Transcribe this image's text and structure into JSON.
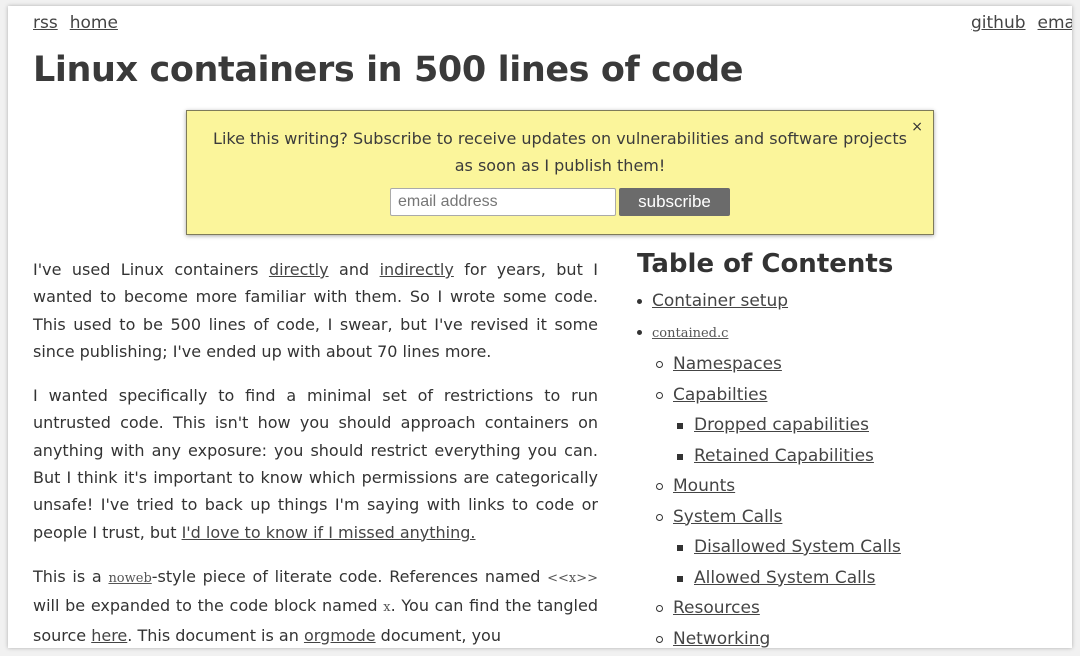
{
  "nav": {
    "left": [
      "rss",
      "home"
    ],
    "right": [
      "github",
      "ema"
    ]
  },
  "title": "Linux containers in 500 lines of code",
  "subscribe": {
    "message": "Like this writing? Subscribe to receive updates on vulnerabilities and software projects as soon as I publish them!",
    "close": "×",
    "placeholder": "email address",
    "button": "subscribe"
  },
  "article": {
    "p1": [
      "I've used Linux containers ",
      "directly",
      " and ",
      "indirectly",
      " for years, but I wanted to become more familiar with them. So I wrote some code. This used to be 500 lines of code, I swear, but I've revised it some since publishing; I've ended up with about 70 lines more."
    ],
    "p2": [
      "I wanted specifically to find a minimal set of restrictions to run untrusted code. This isn't how you should approach containers on anything with any exposure: you should restrict everything you can. But I think it's important to know which permissions are categorically unsafe! I've tried to back up things I'm saying with links to code or people I trust, but ",
      "I'd love to know if I missed anything."
    ],
    "p3": [
      "This is a ",
      "noweb",
      "-style piece of literate code. References named ",
      "<<x>>",
      " will be expanded to the code block named ",
      "x",
      ". You can find the tangled source ",
      "here",
      ". This document is an ",
      "orgmode",
      " document, you"
    ]
  },
  "toc": {
    "title": "Table of Contents",
    "items": [
      {
        "level": 1,
        "label": "Container setup",
        "mono": false
      },
      {
        "level": 1,
        "label": "contained.c",
        "mono": true
      },
      {
        "level": 2,
        "label": "Namespaces",
        "mono": false
      },
      {
        "level": 2,
        "label": "Capabilties",
        "mono": false
      },
      {
        "level": 3,
        "label": "Dropped capabilities",
        "mono": false
      },
      {
        "level": 3,
        "label": "Retained Capabilities",
        "mono": false
      },
      {
        "level": 2,
        "label": "Mounts",
        "mono": false
      },
      {
        "level": 2,
        "label": "System Calls",
        "mono": false
      },
      {
        "level": 3,
        "label": "Disallowed System Calls",
        "mono": false
      },
      {
        "level": 3,
        "label": "Allowed System Calls",
        "mono": false
      },
      {
        "level": 2,
        "label": "Resources",
        "mono": false
      },
      {
        "level": 2,
        "label": "Networking",
        "mono": false
      }
    ]
  }
}
